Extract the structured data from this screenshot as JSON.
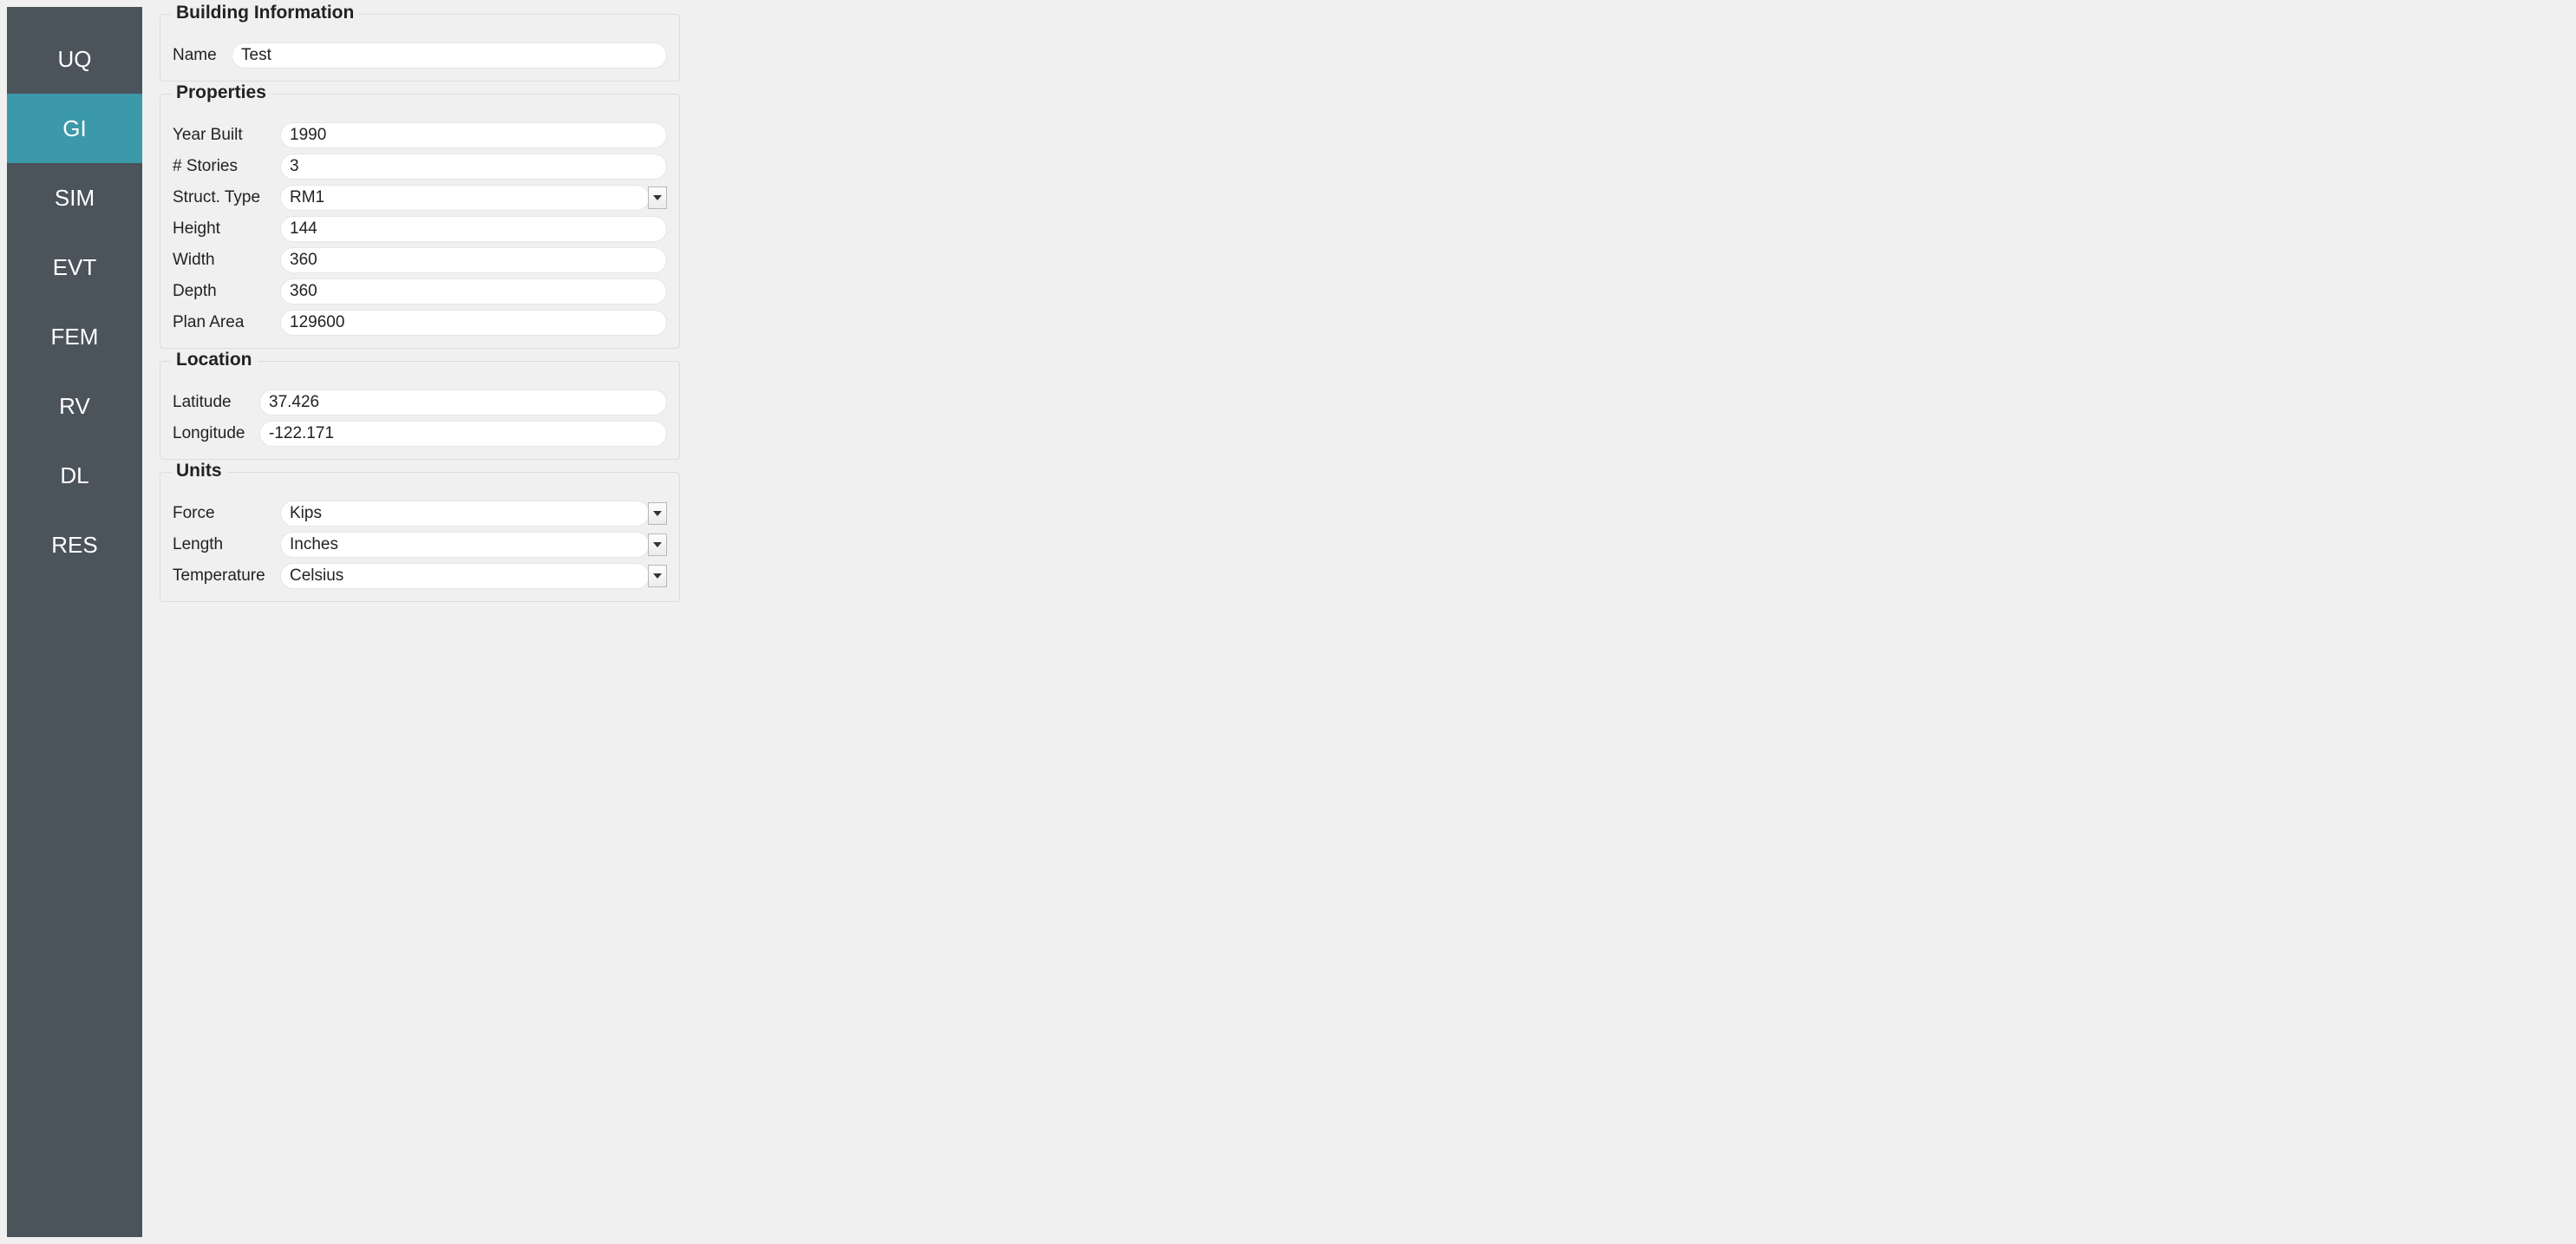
{
  "sidebar": {
    "items": [
      {
        "label": "UQ",
        "active": false
      },
      {
        "label": "GI",
        "active": true
      },
      {
        "label": "SIM",
        "active": false
      },
      {
        "label": "EVT",
        "active": false
      },
      {
        "label": "FEM",
        "active": false
      },
      {
        "label": "RV",
        "active": false
      },
      {
        "label": "DL",
        "active": false
      },
      {
        "label": "RES",
        "active": false
      }
    ]
  },
  "groups": {
    "building_info": {
      "title": "Building Information",
      "name_label": "Name",
      "name_value": "Test"
    },
    "properties": {
      "title": "Properties",
      "year_built_label": "Year Built",
      "year_built_value": "1990",
      "stories_label": "# Stories",
      "stories_value": "3",
      "struct_type_label": "Struct. Type",
      "struct_type_value": "RM1",
      "height_label": "Height",
      "height_value": "144",
      "width_label": "Width",
      "width_value": "360",
      "depth_label": "Depth",
      "depth_value": "360",
      "plan_area_label": "Plan Area",
      "plan_area_value": "129600"
    },
    "location": {
      "title": "Location",
      "latitude_label": "Latitude",
      "latitude_value": "37.426",
      "longitude_label": "Longitude",
      "longitude_value": "-122.171"
    },
    "units": {
      "title": "Units",
      "force_label": "Force",
      "force_value": "Kips",
      "length_label": "Length",
      "length_value": "Inches",
      "temperature_label": "Temperature",
      "temperature_value": "Celsius"
    }
  },
  "colors": {
    "sidebar_bg": "#4b535b",
    "sidebar_active_bg": "#3b99aa",
    "page_bg": "#f0f0f0"
  }
}
